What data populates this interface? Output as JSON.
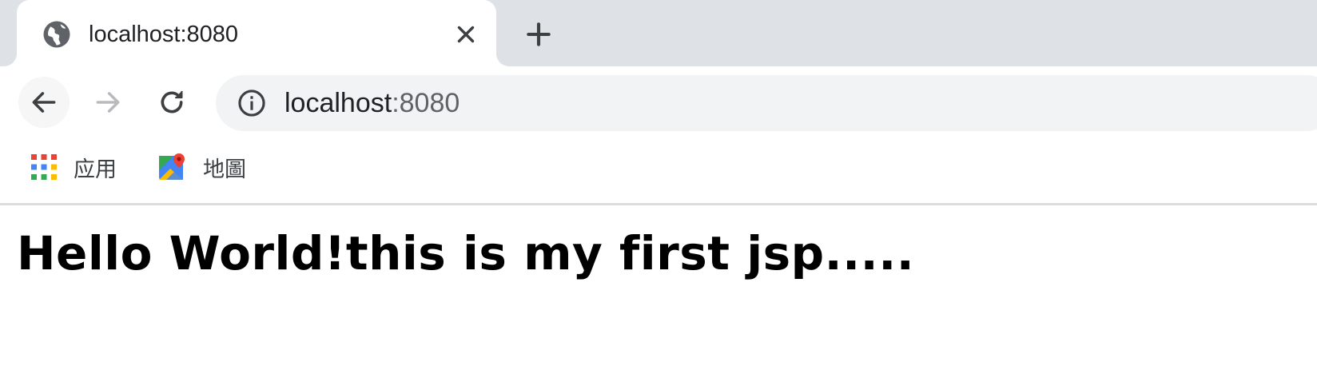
{
  "tab": {
    "title": "localhost:8080",
    "favicon": "globe-icon",
    "close_icon": "close-icon"
  },
  "new_tab": {
    "icon": "plus-icon"
  },
  "toolbar": {
    "back_icon": "arrow-left-icon",
    "forward_icon": "arrow-right-icon",
    "reload_icon": "reload-icon",
    "omnibox": {
      "info_icon": "info-icon",
      "host": "localhost",
      "port": ":8080"
    }
  },
  "bookmarks": [
    {
      "label": "应用",
      "icon": "apps-grid-icon"
    },
    {
      "label": "地圖",
      "icon": "maps-icon"
    }
  ],
  "page": {
    "heading": "Hello World!this is my first jsp....."
  },
  "colors": {
    "tabstrip": "#dee1e6",
    "omnibox": "#f1f3f4",
    "text": "#202124",
    "muted": "#5f6368"
  }
}
